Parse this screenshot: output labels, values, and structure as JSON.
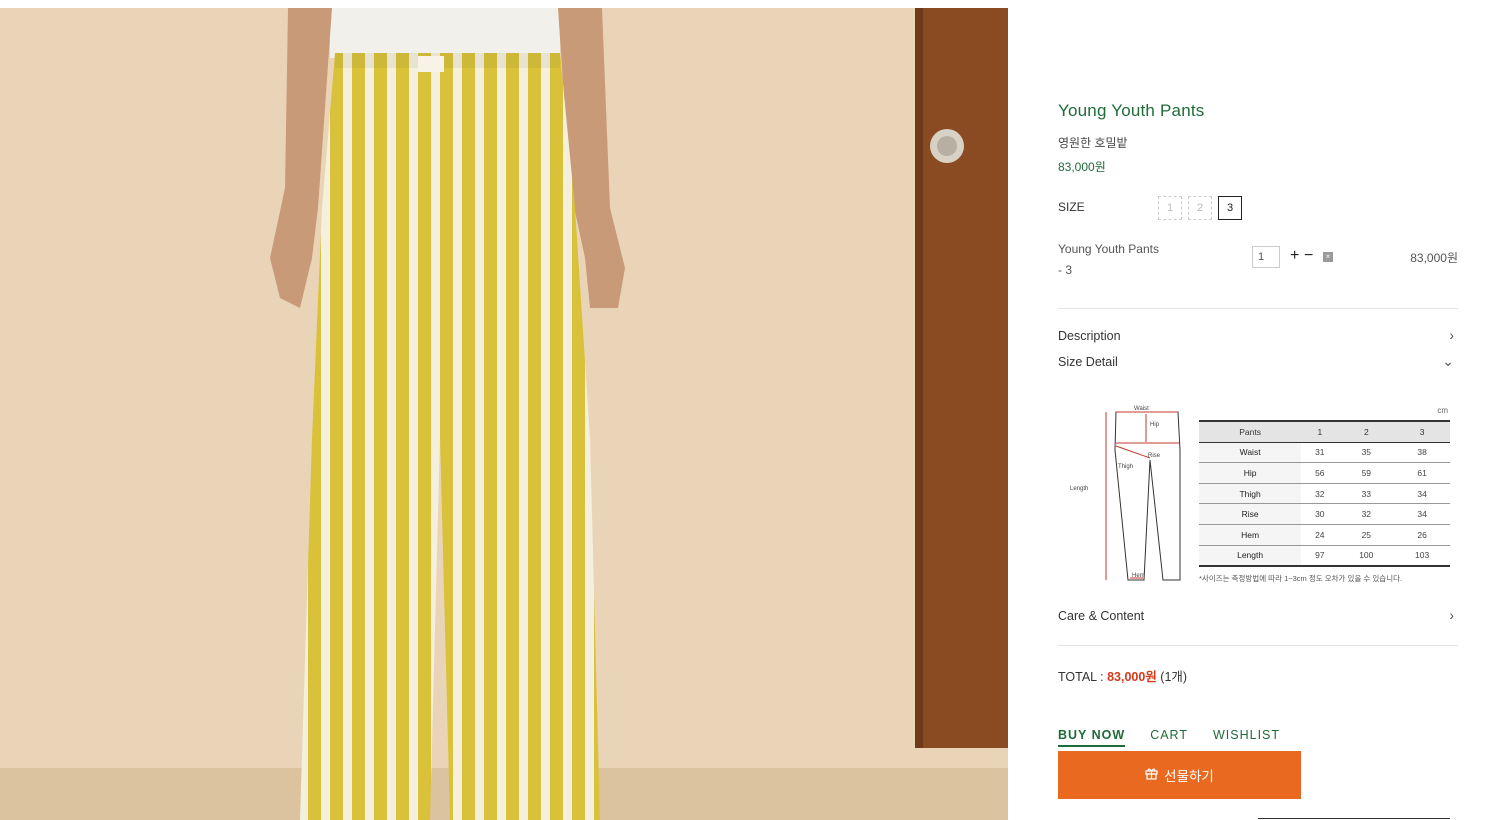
{
  "product": {
    "title": "Young Youth Pants",
    "subtitle": "영원한 호밀밭",
    "price": "83,000원"
  },
  "size": {
    "label": "SIZE",
    "options": [
      "1",
      "2",
      "3"
    ],
    "selected": "3"
  },
  "selection": {
    "name_line1": "Young Youth Pants",
    "name_line2": "- 3",
    "quantity": "1",
    "plus_symbol": "+",
    "minus_symbol": "−",
    "remove_symbol": "×",
    "price": "83,000원"
  },
  "accordion": {
    "description": "Description",
    "size_detail": "Size Detail",
    "care_content": "Care & Content"
  },
  "size_chart": {
    "unit": "cm",
    "diagram_labels": [
      "Waist",
      "Hip",
      "Rise",
      "Thigh",
      "Length",
      "Hem"
    ],
    "headers": [
      "Pants",
      "1",
      "2",
      "3"
    ],
    "rows": [
      {
        "label": "Waist",
        "values": [
          "31",
          "35",
          "38"
        ]
      },
      {
        "label": "Hip",
        "values": [
          "56",
          "59",
          "61"
        ]
      },
      {
        "label": "Thigh",
        "values": [
          "32",
          "33",
          "34"
        ]
      },
      {
        "label": "Rise",
        "values": [
          "30",
          "32",
          "34"
        ]
      },
      {
        "label": "Hem",
        "values": [
          "24",
          "25",
          "26"
        ]
      },
      {
        "label": "Length",
        "values": [
          "97",
          "100",
          "103"
        ]
      }
    ],
    "note": "*사이즈는 측정방법에 따라 1~3cm 정도 오차가 있을 수 있습니다."
  },
  "total": {
    "label": "TOTAL : ",
    "amount": "83,000원",
    "count": " (1개)"
  },
  "actions": {
    "buy_now": "BUY NOW",
    "cart": "CART",
    "wishlist": "WISHLIST",
    "gift": "선물하기"
  },
  "colors": {
    "accent_green": "#1f6b3a",
    "gift_orange": "#e8691f",
    "total_red": "#d33a1c"
  }
}
